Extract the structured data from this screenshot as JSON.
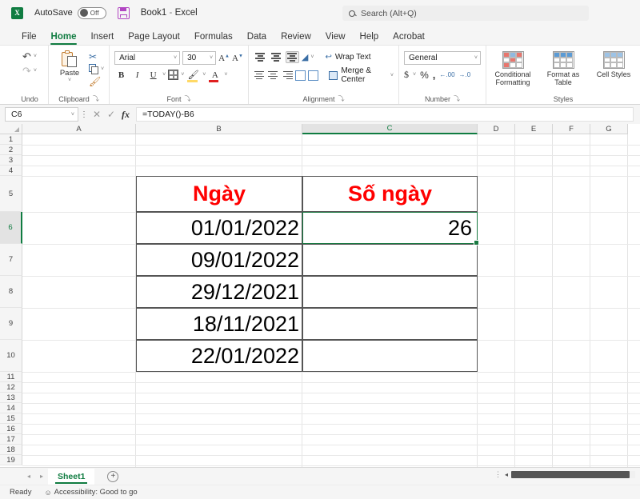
{
  "titlebar": {
    "app_logo": "excel-logo",
    "logo_letter": "X",
    "autosave_label": "AutoSave",
    "autosave_state": "Off",
    "save_icon": "save-icon",
    "doc_name": "Book1",
    "separator": "-",
    "app_name": "Excel"
  },
  "search": {
    "icon": "search-icon",
    "placeholder": "Search (Alt+Q)"
  },
  "tabs": [
    {
      "label": "File",
      "active": false
    },
    {
      "label": "Home",
      "active": true
    },
    {
      "label": "Insert",
      "active": false
    },
    {
      "label": "Page Layout",
      "active": false
    },
    {
      "label": "Formulas",
      "active": false
    },
    {
      "label": "Data",
      "active": false
    },
    {
      "label": "Review",
      "active": false
    },
    {
      "label": "View",
      "active": false
    },
    {
      "label": "Help",
      "active": false
    },
    {
      "label": "Acrobat",
      "active": false
    }
  ],
  "ribbon": {
    "undo": {
      "group_label": "Undo",
      "undo_icon": "undo-arrow-icon",
      "redo_icon": "redo-arrow-icon",
      "caret": "˅"
    },
    "clipboard": {
      "group_label": "Clipboard",
      "paste_label": "Paste",
      "paste_icon": "clipboard-icon",
      "cut_icon": "scissors-icon",
      "copy_icon": "copy-icon",
      "format_painter_icon": "format-painter-icon",
      "dialog_launcher": "⤵"
    },
    "font": {
      "group_label": "Font",
      "font_name": "Arial",
      "font_size": "30",
      "grow_font": "A",
      "shrink_font": "A",
      "bold": "B",
      "italic": "I",
      "underline": "U",
      "borders_icon": "borders-icon",
      "fill_color_icon": "fill-color-icon",
      "font_color_icon": "font-color-icon",
      "font_color": "#e02020",
      "dialog_launcher": "⤵"
    },
    "alignment": {
      "group_label": "Alignment",
      "wrap_text": "Wrap Text",
      "merge_center": "Merge & Center",
      "top_align_icon": "align-top-icon",
      "middle_align_icon": "align-middle-icon",
      "bottom_align_icon": "align-bottom-icon",
      "orientation_icon": "orientation-icon",
      "align_left_icon": "align-left-icon",
      "align_center_icon": "align-center-icon",
      "align_right_icon": "align-right-icon",
      "decrease_indent_icon": "decrease-indent-icon",
      "increase_indent_icon": "increase-indent-icon",
      "dialog_launcher": "⤵"
    },
    "number": {
      "group_label": "Number",
      "format": "General",
      "currency_icon": "currency-icon",
      "percent_icon": "percent-icon",
      "comma_icon": "comma-style-icon",
      "increase_decimal_icon": "increase-decimal-icon",
      "decrease_decimal_icon": "decrease-decimal-icon",
      "dialog_launcher": "⤵"
    },
    "styles": {
      "group_label": "Styles",
      "conditional_formatting": "Conditional Formatting",
      "format_as_table": "Format as Table",
      "cell_styles": "Cell Styles",
      "caret": "˅"
    }
  },
  "formula_bar": {
    "name_box": "C6",
    "name_box_caret": "˅",
    "more_icon": "more-options-icon",
    "cancel_icon": "✕",
    "enter_icon": "✓",
    "function_icon": "fx",
    "formula": "=TODAY()-B6"
  },
  "grid": {
    "columns": [
      "A",
      "B",
      "C",
      "D",
      "E",
      "F",
      "G"
    ],
    "selected_column": "C",
    "rows": [
      "1",
      "2",
      "3",
      "4",
      "5",
      "6",
      "7",
      "8",
      "9",
      "10",
      "11",
      "12",
      "13",
      "14",
      "15",
      "16",
      "17",
      "18",
      "19"
    ],
    "selected_row": "6",
    "table": {
      "headers": [
        "Ngày",
        "Số ngày"
      ],
      "header_color": "#ff0000",
      "dates": [
        "01/01/2022",
        "09/01/2022",
        "29/12/2021",
        "18/11/2021",
        "22/01/2022"
      ],
      "days_values": [
        "26",
        "",
        "",
        "",
        ""
      ]
    },
    "selection_color": "#1a7a42"
  },
  "sheetbar": {
    "prev_icon": "◂",
    "next_icon": "▸",
    "sheets": [
      "Sheet1"
    ],
    "add_sheet_icon": "+",
    "scroll_dots": "⋮",
    "scroll_left_icon": "◂"
  },
  "statusbar": {
    "mode": "Ready",
    "accessibility_icon": "accessibility-icon",
    "accessibility": "Accessibility: Good to go"
  }
}
